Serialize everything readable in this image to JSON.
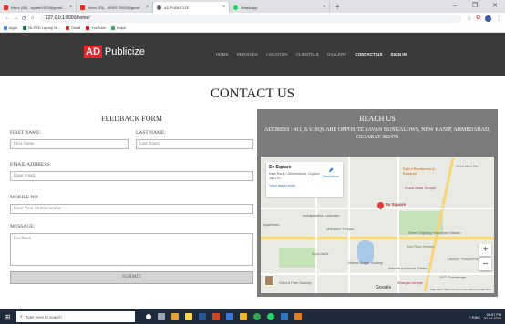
{
  "browser": {
    "tabs": [
      {
        "title": "Inbox (58) - tcpatel1923@gmail.com",
        "color": "#d93025",
        "active": false
      },
      {
        "title": "Inbox (53) - 4096173953@gmail",
        "color": "#d93025",
        "active": false
      },
      {
        "title": "AD PUBLICIZE",
        "color": "#5f6368",
        "active": true
      },
      {
        "title": "WhatsApp",
        "color": "#25d366",
        "active": false
      }
    ],
    "new_tab": "+",
    "window_controls": {
      "minimize": "–",
      "restore": "❐",
      "close": "✕"
    },
    "url": "127.0.0.1:8000/home/",
    "nav": {
      "back": "←",
      "forward": "→",
      "reload": "⟳",
      "home": "⌂"
    },
    "toolbar_icons": {
      "star": "☆",
      "opera": "O",
      "menu": "⋮"
    },
    "bookmarks": [
      {
        "label": "Apps",
        "color": "#4285f4"
      },
      {
        "label": "NI-PSD Laptop M...",
        "color": "#0b8043"
      },
      {
        "label": "Gmail",
        "color": "#d93025"
      },
      {
        "label": "YouTube",
        "color": "#ff0000"
      },
      {
        "label": "Maps",
        "color": "#34a853"
      }
    ]
  },
  "site": {
    "logo_mark": "AD",
    "logo_text": "Publicize",
    "nav": [
      {
        "label": "HOME",
        "active": false
      },
      {
        "label": "SERVICES",
        "active": false
      },
      {
        "label": "LOCATION",
        "active": false
      },
      {
        "label": "CLIENTELE",
        "active": false
      },
      {
        "label": "GALLERY",
        "active": false
      },
      {
        "label": "CONTACT US",
        "active": true
      },
      {
        "label": "SIGN IN",
        "active": true
      }
    ]
  },
  "page": {
    "title": "CONTACT US",
    "form": {
      "heading": "FEEDBACK FORM",
      "first_name_label": "FIRST NAME:",
      "first_name_placeholder": "First Name",
      "last_name_label": "LAST NAME:",
      "last_name_placeholder": "Last Name",
      "email_label": "EMAIL ADDRESS:",
      "email_placeholder": "Enter email",
      "mobile_label": "MOBILE NO:",
      "mobile_placeholder": "Enter Your Mobilenumber",
      "message_label": "MESSAGE:",
      "message_placeholder": "Feedback",
      "submit_label": "SUBMIT"
    },
    "reach": {
      "heading": "REACH US",
      "address": "ADDRESS : 411, S.V. SQUARE OPPOSITE SAVAN BUNGALOWS, NEW RANIP, AHMEDABAD, GUJARAT 382470"
    },
    "map": {
      "card_name": "Sv Square",
      "card_address": "New Ranip, Ahmedabad, Gujarat 382470",
      "card_link": "View larger map",
      "card_directions": "Directions",
      "pin_label": "Sv Square",
      "labels": [
        "Vinal Maa Ter",
        "Indraprastha 4 Ashram",
        "Mahadev Temple",
        "Shree Digvijay Hanuman Mandir",
        "UNION TRANSPORT CO",
        "Apartment",
        "Arya Bank",
        "Sun Real Homes",
        "Arbuda Industrial Estate",
        "Oxford Park Society",
        "Nirmal Nagar Society",
        "Bhargav temple",
        "GST Overbridge"
      ],
      "poi_orange": "Rahul Restaurant & Banquet",
      "poi_pink": "Khodi Mata Temple",
      "zoom_in": "+",
      "zoom_out": "−",
      "google": "Google",
      "attribution": "Map data ©2020  Terms of Use  Report a map error"
    }
  },
  "taskbar": {
    "start_icon": "⊞",
    "search_placeholder": "Type here to search",
    "search_icon": "⌕",
    "apps": [
      {
        "name": "task-view",
        "color": "#ffffff"
      },
      {
        "name": "store",
        "color": "#9aa4b5"
      },
      {
        "name": "wallet",
        "color": "#e8a23a"
      },
      {
        "name": "sticky-notes",
        "color": "#ffd84d"
      },
      {
        "name": "word",
        "color": "#2b579a"
      },
      {
        "name": "powerpoint",
        "color": "#d04423"
      },
      {
        "name": "photos",
        "color": "#3c78d8"
      },
      {
        "name": "explorer",
        "color": "#f3b72b"
      },
      {
        "name": "chrome",
        "color": "#34a853"
      },
      {
        "name": "whatsapp",
        "color": "#25d366"
      },
      {
        "name": "edge",
        "color": "#3277bc"
      },
      {
        "name": "paint",
        "color": "#e67c22"
      }
    ],
    "tray": "^  ENG",
    "time": "06:57 PM",
    "date": "20-04-2020"
  }
}
